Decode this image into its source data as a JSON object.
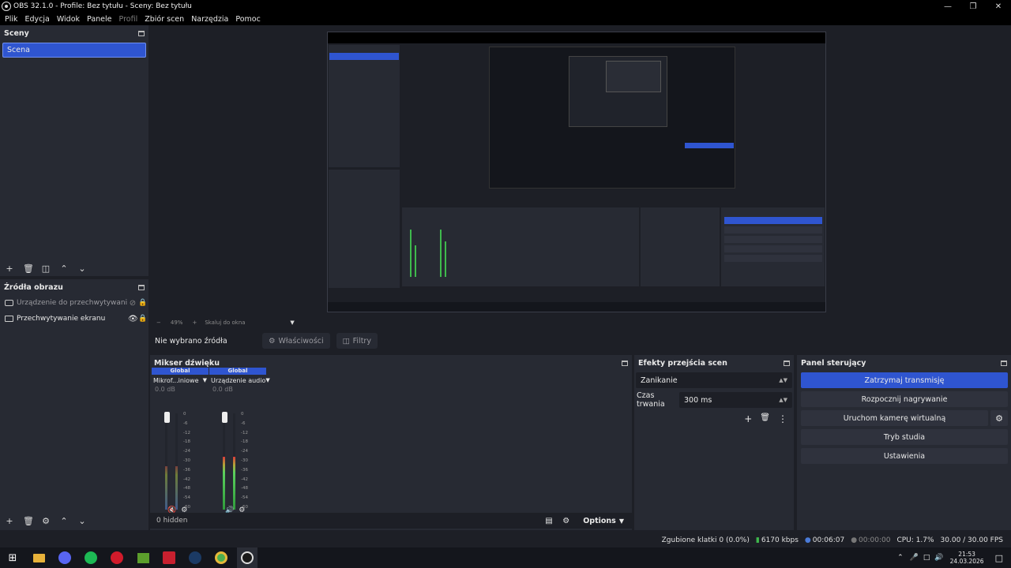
{
  "window": {
    "title": "OBS 32.1.0 - Profile: Bez tytułu - Sceny: Bez tytułu"
  },
  "menu": {
    "items": [
      "Plik",
      "Edycja",
      "Widok",
      "Panele",
      "Profil",
      "Zbiór scen",
      "Narzędzia",
      "Pomoc"
    ]
  },
  "scenes": {
    "title": "Sceny",
    "items": [
      "Scena"
    ]
  },
  "sources": {
    "title": "Źródła obrazu",
    "items": [
      {
        "name": "Urządzenie do przechwytywani..."
      },
      {
        "name": "Przechwytywanie ekranu"
      }
    ]
  },
  "preview": {
    "zoom": "49%",
    "scale_mode": "Skaluj do okna"
  },
  "context": {
    "no_source": "Nie wybrano źródła",
    "properties": "Właściwości",
    "filters": "Filtry"
  },
  "mixer": {
    "title": "Mikser dźwięku",
    "channels": [
      {
        "tag": "Global",
        "name": "Mikrof...iniowe",
        "db": "0.0 dB",
        "level": 0.45,
        "muted": true
      },
      {
        "tag": "Global",
        "name": "Urządzenie audio",
        "db": "0.0 dB",
        "level": 0.55,
        "muted": false
      }
    ],
    "ticks": [
      "0",
      "-6",
      "-12",
      "-18",
      "-24",
      "-30",
      "-36",
      "-42",
      "-48",
      "-54",
      "-60"
    ],
    "hidden": "0 hidden",
    "options": "Options"
  },
  "transitions": {
    "title": "Efekty przejścia scen",
    "selected": "Zanikanie",
    "duration_label": "Czas trwania",
    "duration": "300 ms"
  },
  "controls": {
    "title": "Panel sterujący",
    "stream": "Zatrzymaj transmisję",
    "record": "Rozpocznij nagrywanie",
    "virtual_cam": "Uruchom kamerę wirtualną",
    "studio": "Tryb studia",
    "settings": "Ustawienia"
  },
  "status": {
    "dropped": "Zgubione klatki 0 (0.0%)",
    "bitrate": "6170 kbps",
    "stream_time": "00:06:07",
    "rec_time": "00:00:00",
    "cpu": "CPU: 1.7%",
    "fps": "30.00 / 30.00 FPS"
  },
  "taskbar": {
    "time": "21:53",
    "date": "24.03.2026"
  },
  "colors": {
    "accent": "#2f55d0",
    "bg": "#1d1f26",
    "panel": "#272a33"
  }
}
